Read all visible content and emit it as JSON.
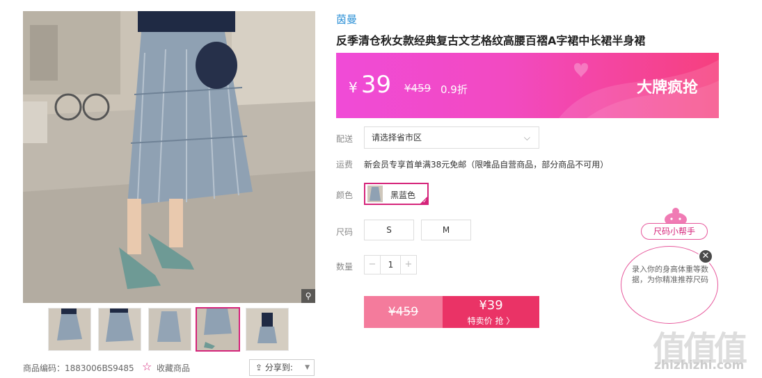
{
  "gallery": {
    "zoom_icon": "magnifier-icon",
    "thumbnails_count": 5,
    "active_index": 3
  },
  "footer": {
    "product_code": "商品编码：1883006BS9485",
    "favorite_label": "收藏商品",
    "share_label": "分享到:"
  },
  "product": {
    "brand": "茵曼",
    "title": "反季清仓秋女款经典复古文艺格纹高腰百褶A字裙中长裙半身裙"
  },
  "price_banner": {
    "currency": "¥",
    "sale_price": "39",
    "original_price": "¥459",
    "discount": "0.9折",
    "promo_label": "大牌疯抢"
  },
  "options": {
    "delivery_label": "配送",
    "region_placeholder": "请选择省市区",
    "shipping_label": "运费",
    "shipping_text": "新会员专享首单满38元免邮（限唯品自营商品，部分商品不可用）",
    "color_label": "颜色",
    "color_value": "黑蓝色",
    "size_label": "尺码",
    "sizes": [
      "S",
      "M"
    ],
    "qty_label": "数量",
    "qty_minus": "−",
    "qty_value": "1",
    "qty_plus": "+"
  },
  "buy": {
    "original_price": "¥459",
    "sale_price": "¥39",
    "sale_label": "特卖价 抢 〉"
  },
  "size_helper": {
    "tab_label": "尺码小帮手",
    "text": "录入你的身高体重等数据，为你精准推荐尺码",
    "close": "✕"
  },
  "watermark": {
    "glyphs": "值值值",
    "url": "zhizhizhi.com"
  },
  "colors": {
    "brand_blue": "#2a8fd6",
    "accent_pink": "#d5247a",
    "buy_pink": "#ea3366",
    "buy_pink_light": "#f47b9c"
  }
}
